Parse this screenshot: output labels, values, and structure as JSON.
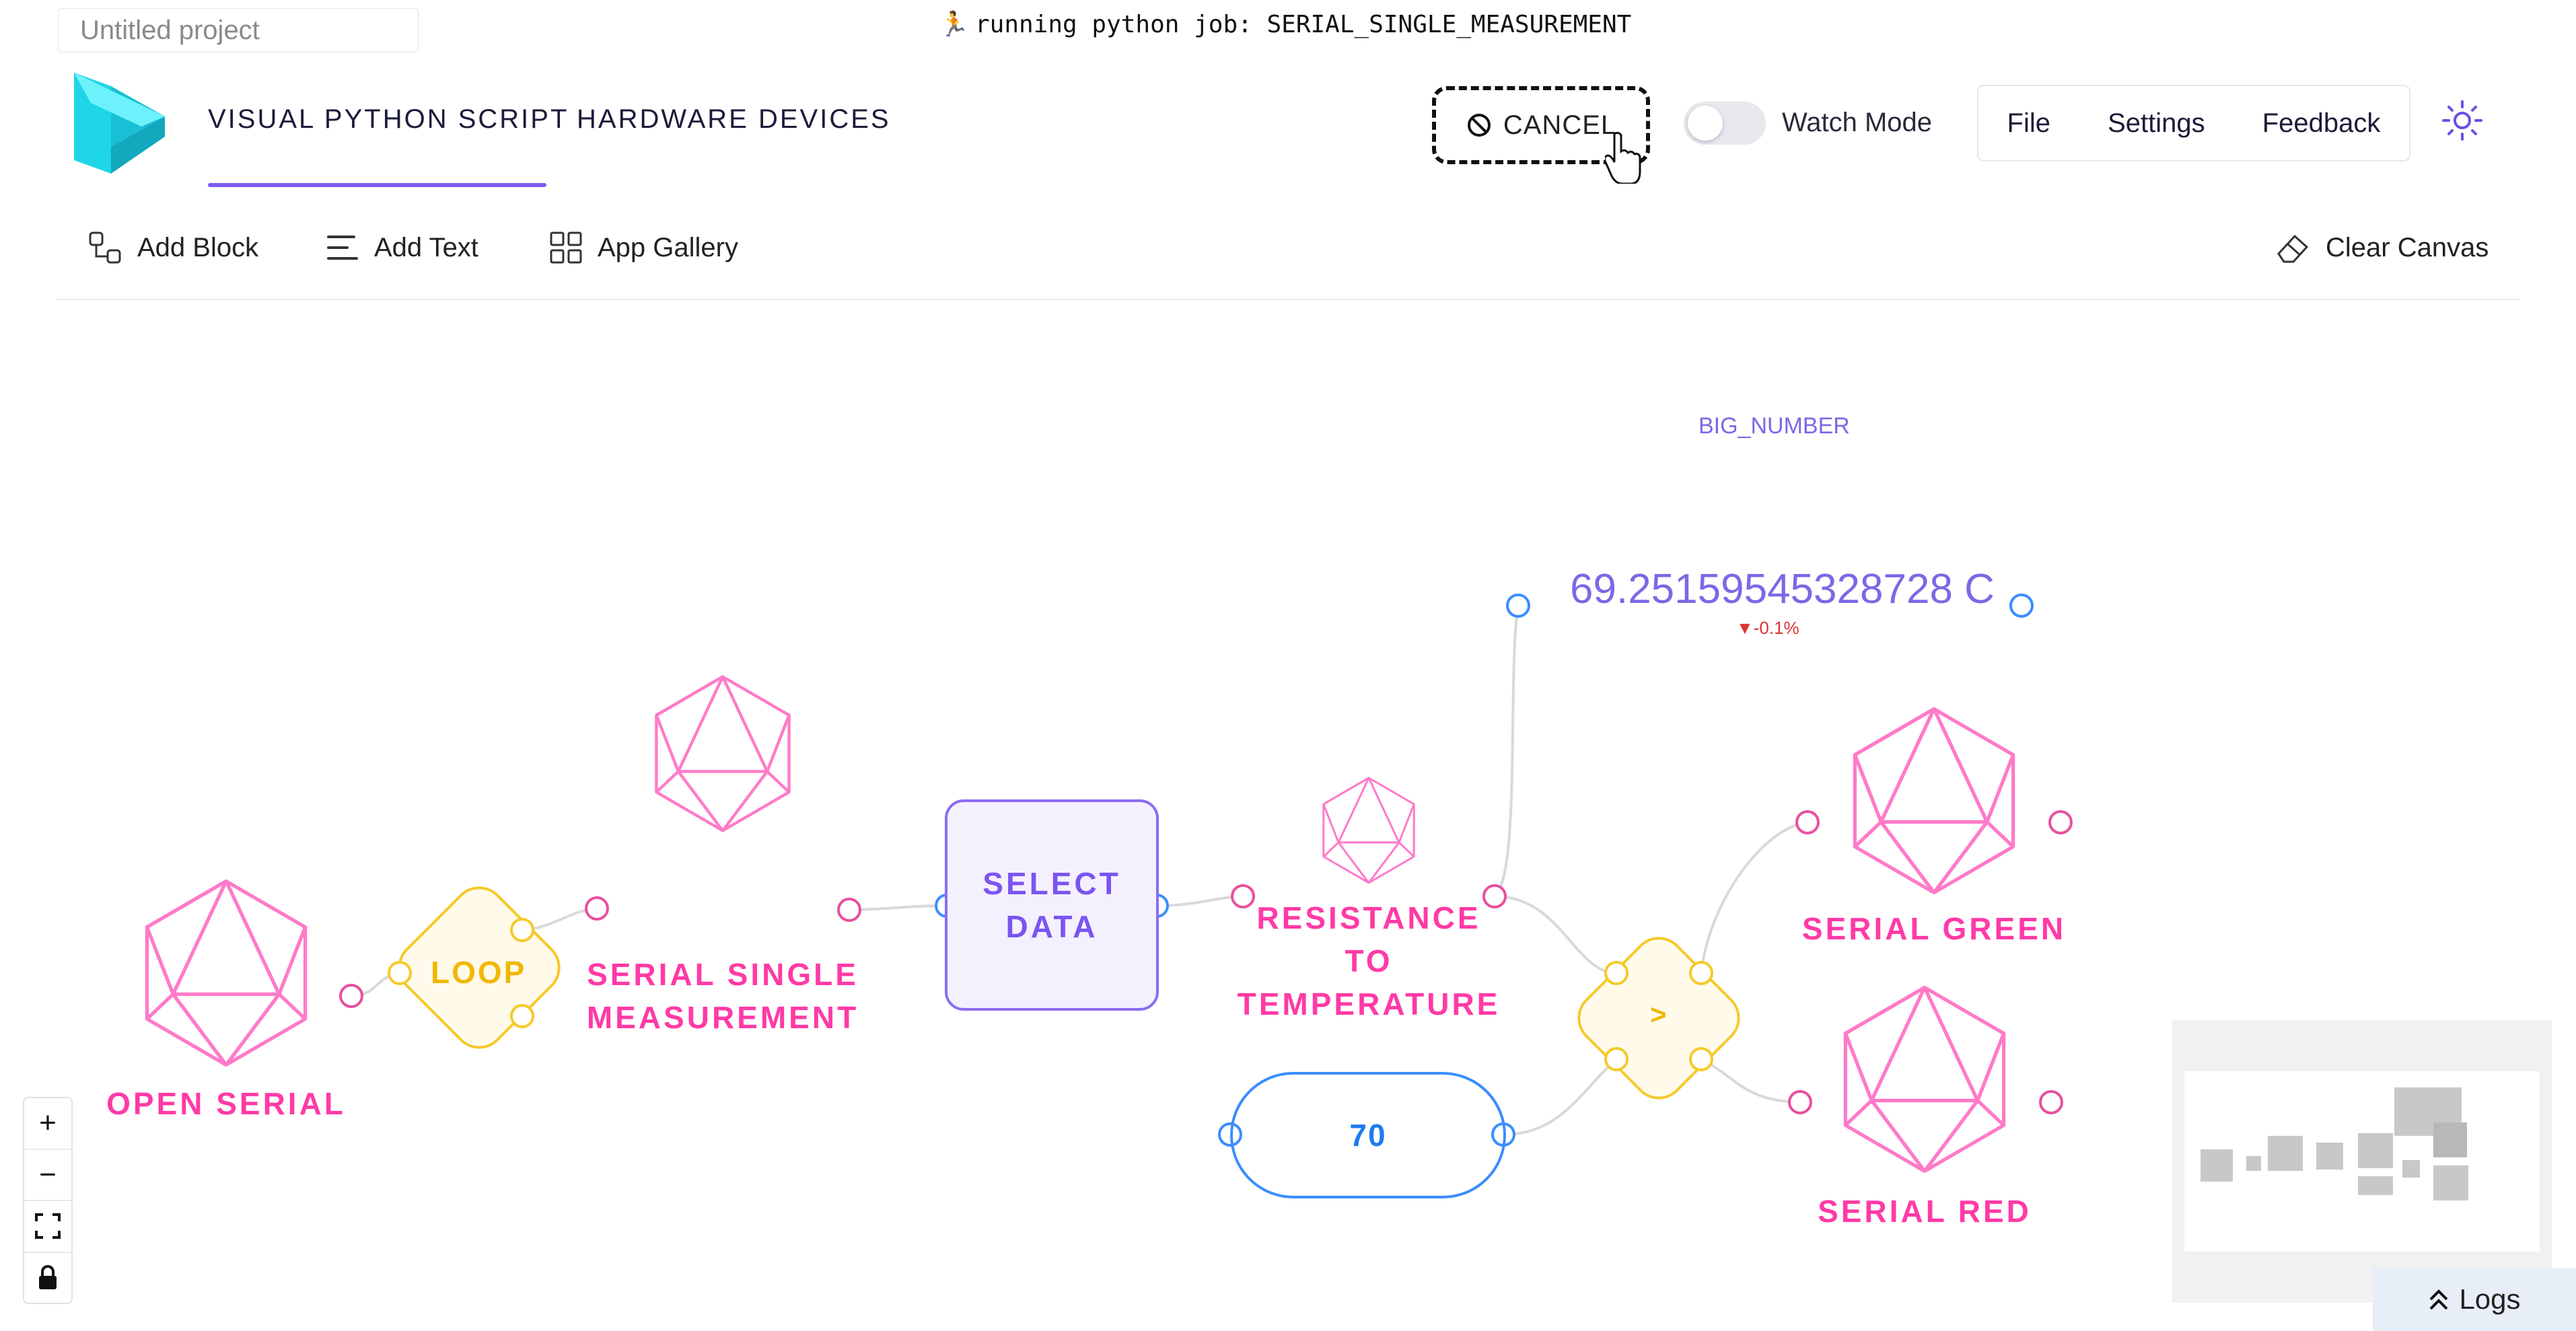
{
  "project": {
    "name": "Untitled project"
  },
  "job_status": {
    "text": "running python job: SERIAL_SINGLE_MEASUREMENT",
    "icon": "runner-icon"
  },
  "nav": {
    "tabs": [
      {
        "label": "VISUAL PYTHON SCRIPT",
        "active": true
      },
      {
        "label": "HARDWARE DEVICES",
        "active": false
      }
    ],
    "cancel_label": "CANCEL",
    "watch_mode_label": "Watch Mode",
    "watch_mode_on": false,
    "menu": [
      "File",
      "Settings",
      "Feedback"
    ]
  },
  "toolbar": {
    "add_block": "Add Block",
    "add_text": "Add Text",
    "app_gallery": "App Gallery",
    "clear_canvas": "Clear Canvas"
  },
  "canvas": {
    "big_number": {
      "title": "BIG_NUMBER",
      "value": "69.25159545328728 C",
      "delta": "▼-0.1%"
    },
    "nodes": {
      "open_serial": "OPEN SERIAL",
      "loop": "LOOP",
      "serial_single_measurement": [
        "SERIAL SINGLE",
        "MEASUREMENT"
      ],
      "select_data": [
        "SELECT",
        "DATA"
      ],
      "resistance_to_temperature": [
        "RESISTANCE",
        "TO",
        "TEMPERATURE"
      ],
      "constant": "70",
      "compare": ">",
      "serial_green": "SERIAL GREEN",
      "serial_red": "SERIAL RED"
    }
  },
  "controls": {
    "zoom_in": "+",
    "zoom_out": "−",
    "fit_view": "⛶",
    "lock": "🔒"
  },
  "logs": {
    "label": "Logs"
  },
  "colors": {
    "accent": "#7b5cf0",
    "pink": "#ff3aa6",
    "yellow": "#f2b705",
    "blue": "#3c8dff",
    "purple_text": "#7b68e6"
  }
}
